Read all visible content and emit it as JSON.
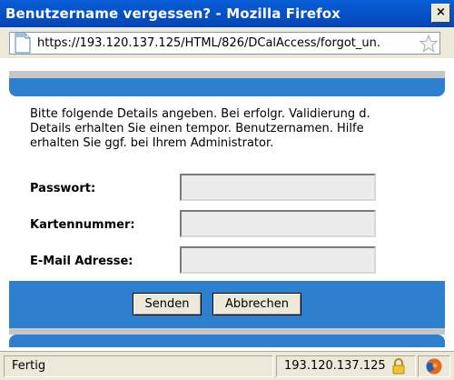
{
  "window": {
    "title": "Benutzername vergessen? - Mozilla Firefox",
    "close_label": "×"
  },
  "urlbar": {
    "url": "https://193.120.137.125/HTML/826/DCalAccess/forgot_un.",
    "page_icon": "page-icon",
    "bookmark_icon": "star-icon"
  },
  "form": {
    "intro": "Bitte folgende Details angeben. Bei erfolgr. Validierung d. Details erhalten Sie einen tempor. Benutzernamen. Hilfe erhalten Sie ggf. bei Ihrem Administrator.",
    "password_label": "Passwort:",
    "password_value": "",
    "card_label": "Kartennummer:",
    "card_value": "",
    "email_label": "E-Mail Adresse:",
    "email_value": "",
    "submit_label": "Senden",
    "cancel_label": "Abbrechen"
  },
  "status": {
    "text": "Fertig",
    "host": "193.120.137.125",
    "lock_icon": "lock-icon",
    "firefox_icon": "firefox-icon"
  },
  "colors": {
    "titlebar": "#0a5fd8",
    "accent_bar": "#2f7fcf",
    "window_bg": "#ece9d8"
  }
}
